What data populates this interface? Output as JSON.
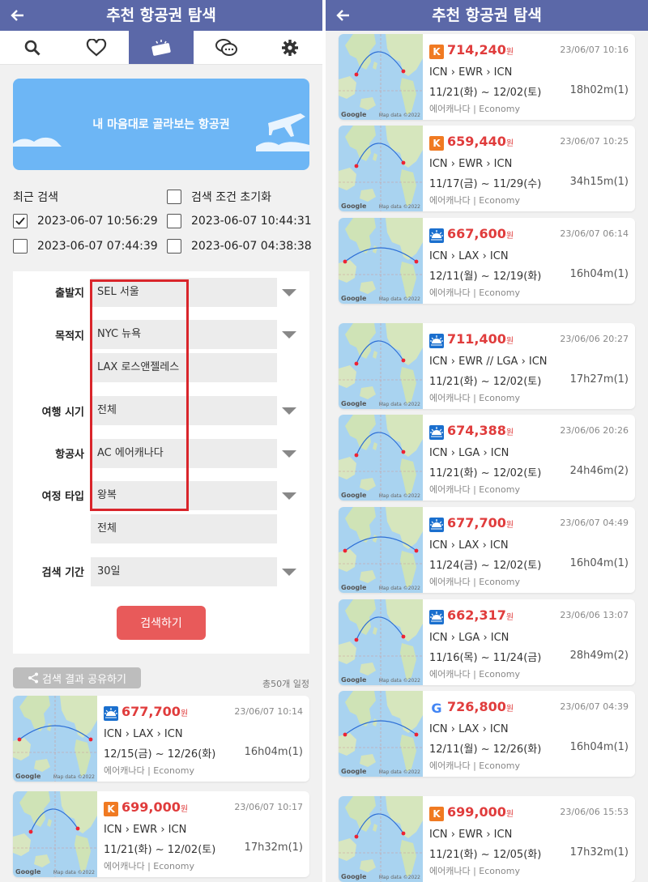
{
  "title": "추천 항공권 탐색",
  "banner_text": "내 마음대로 골라보는 항공권",
  "recent_label": "최근 검색",
  "reset_label": "검색 조건 초기화",
  "recent": [
    {
      "text": "2023-06-07 10:56:29",
      "checked": true
    },
    {
      "text": "2023-06-07 10:44:31",
      "checked": false
    },
    {
      "text": "2023-06-07 07:44:39",
      "checked": false
    },
    {
      "text": "2023-06-07 04:38:38",
      "checked": false
    }
  ],
  "form": {
    "origin_label": "출발지",
    "origin": "SEL 서울",
    "dest_label": "목적지",
    "dest1": "NYC 뉴욕",
    "dest2": "LAX 로스앤젤레스",
    "period_label": "여행 시기",
    "period": "전체",
    "airline_label": "항공사",
    "airline": "AC 에어캐나다",
    "trip_label": "여정 타입",
    "trip1": "왕복",
    "trip2": "전체",
    "range_label": "검색 기간",
    "range": "30일",
    "search_button": "검색하기"
  },
  "share_label": "검색 결과 공유하기",
  "total_label": "총50개 일정",
  "map_google": "Google",
  "map_data": "Map data ©2022",
  "won": "원",
  "colors": {
    "header": "#5b68a8",
    "price": "#e03c3c",
    "k": "#f07a22",
    "ac": "#1a6fce",
    "search_btn": "#e85a5a"
  },
  "left_cards": [
    {
      "icon": "ac",
      "price": "677,700",
      "ts": "23/06/07 10:14",
      "route": "ICN › LAX › ICN",
      "dates": "12/15(금) ~ 12/26(화)",
      "dur": "16h04m(1)",
      "meta": "에어캐나다 | Economy",
      "map": "pacific"
    },
    {
      "icon": "k",
      "price": "699,000",
      "ts": "23/06/07 10:17",
      "route": "ICN › EWR › ICN",
      "dates": "11/21(화) ~ 12/02(토)",
      "dur": "17h32m(1)",
      "meta": "에어캐나다 | Economy",
      "map": "polar"
    }
  ],
  "right_cards": [
    {
      "icon": "k",
      "price": "714,240",
      "ts": "23/06/07 10:16",
      "route": "ICN › EWR › ICN",
      "dates": "11/21(화) ~ 12/02(토)",
      "dur": "18h02m(1)",
      "meta": "에어캐나다 | Economy",
      "map": "polar"
    },
    {
      "icon": "k",
      "price": "659,440",
      "ts": "23/06/07 10:25",
      "route": "ICN › EWR › ICN",
      "dates": "11/17(금) ~ 11/29(수)",
      "dur": "34h15m(1)",
      "meta": "에어캐나다 | Economy",
      "map": "polar"
    },
    {
      "icon": "ac",
      "price": "667,600",
      "ts": "23/06/07 06:14",
      "route": "ICN › LAX › ICN",
      "dates": "12/11(월) ~ 12/19(화)",
      "dur": "16h04m(1)",
      "meta": "에어캐나다 | Economy",
      "map": "pacific"
    },
    {
      "icon": "ac",
      "price": "711,400",
      "ts": "23/06/06 20:27",
      "route": "ICN › EWR // LGA › ICN",
      "dates": "11/21(화) ~ 12/02(토)",
      "dur": "17h27m(1)",
      "meta": "에어캐나다 | Economy",
      "map": "polar"
    },
    {
      "icon": "ac",
      "price": "674,388",
      "ts": "23/06/06 20:26",
      "route": "ICN › LGA › ICN",
      "dates": "11/21(화) ~ 12/02(토)",
      "dur": "24h46m(2)",
      "meta": "에어캐나다 | Economy",
      "map": "polar"
    },
    {
      "icon": "ac",
      "price": "677,700",
      "ts": "23/06/07 04:49",
      "route": "ICN › LAX › ICN",
      "dates": "11/24(금) ~ 12/02(토)",
      "dur": "16h04m(1)",
      "meta": "에어캐나다 | Economy",
      "map": "pacific"
    },
    {
      "icon": "ac",
      "price": "662,317",
      "ts": "23/06/06 13:07",
      "route": "ICN › LGA › ICN",
      "dates": "11/16(목) ~ 11/24(금)",
      "dur": "28h49m(2)",
      "meta": "에어캐나다 | Economy",
      "map": "polar"
    },
    {
      "icon": "g",
      "price": "726,800",
      "ts": "23/06/07 04:39",
      "route": "ICN › LAX › ICN",
      "dates": "12/11(월) ~ 12/26(화)",
      "dur": "16h04m(1)",
      "meta": "에어캐나다 | Economy",
      "map": "pacific"
    },
    {
      "icon": "k",
      "price": "699,000",
      "ts": "23/06/06 15:53",
      "route": "ICN › EWR › ICN",
      "dates": "11/21(화) ~ 12/05(화)",
      "dur": "17h32m(1)",
      "meta": "에어캐나다 | Economy",
      "map": "polar"
    }
  ]
}
